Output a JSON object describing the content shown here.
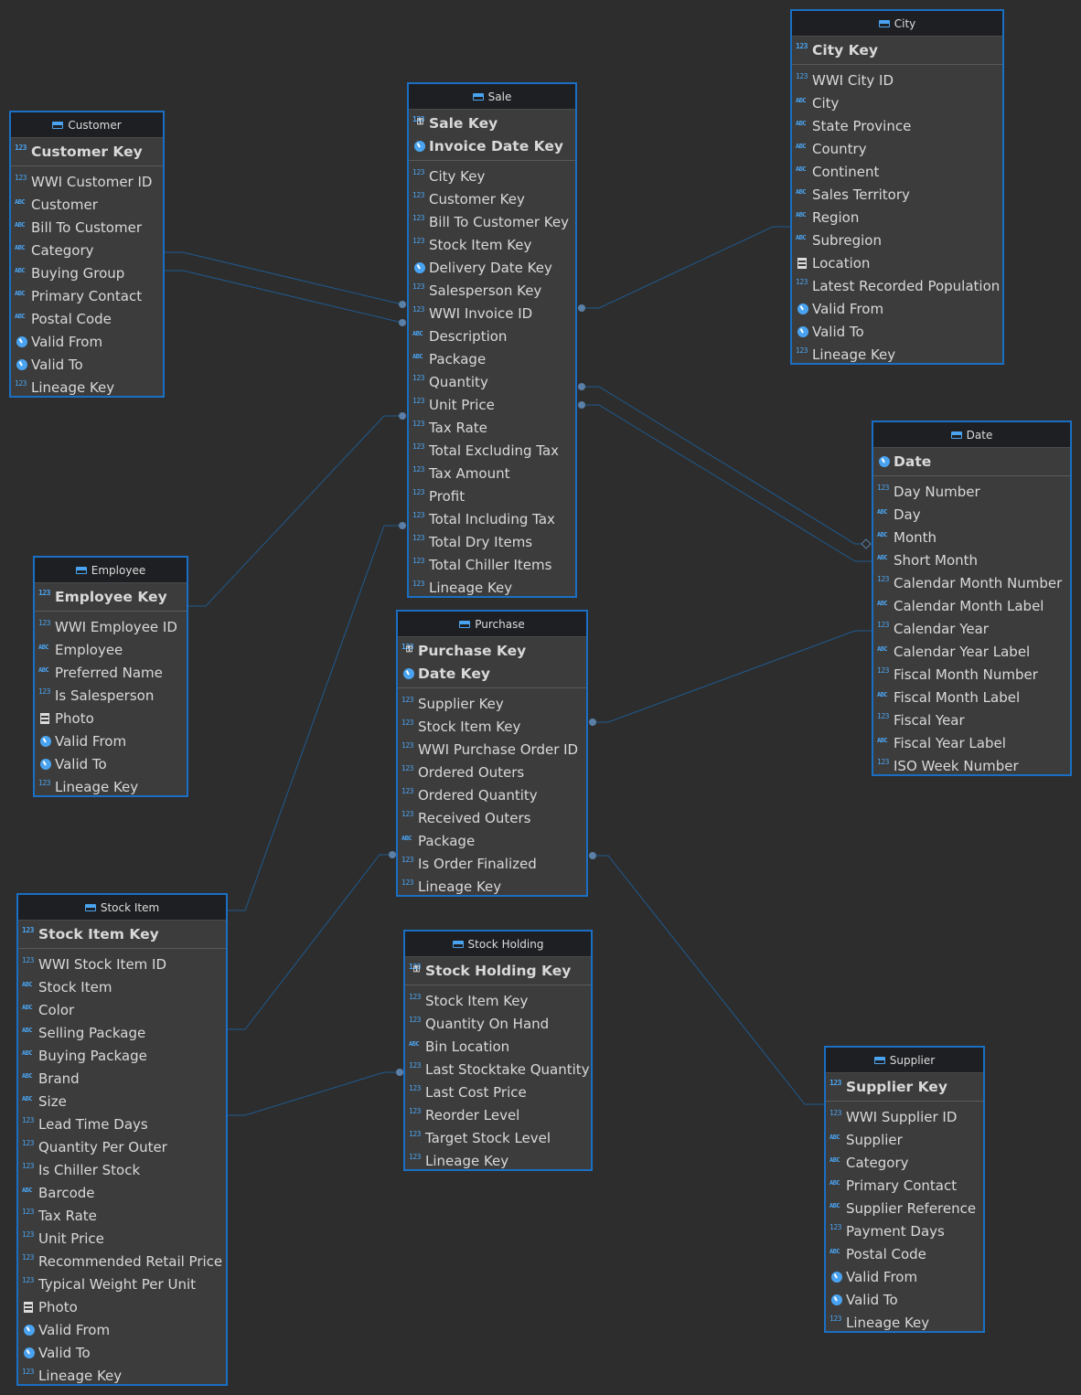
{
  "colors": {
    "background": "#2d2d2d",
    "entity_border": "#1a6fc4",
    "entity_body": "#3c3c3c",
    "type_icon": "#4aa3f0",
    "link": "#1f5a8f"
  },
  "entities": {
    "customer": {
      "title": "Customer",
      "keys": [
        {
          "type": "123",
          "label": "Customer Key"
        }
      ],
      "columns": [
        {
          "type": "123",
          "label": "WWI Customer ID"
        },
        {
          "type": "abc",
          "label": "Customer"
        },
        {
          "type": "abc",
          "label": "Bill To Customer"
        },
        {
          "type": "abc",
          "label": "Category"
        },
        {
          "type": "abc",
          "label": "Buying Group"
        },
        {
          "type": "abc",
          "label": "Primary Contact"
        },
        {
          "type": "abc",
          "label": "Postal Code"
        },
        {
          "type": "clock",
          "label": "Valid From"
        },
        {
          "type": "clock",
          "label": "Valid To"
        },
        {
          "type": "123",
          "label": "Lineage Key"
        }
      ]
    },
    "sale": {
      "title": "Sale",
      "keys": [
        {
          "type": "key",
          "label": "Sale Key"
        },
        {
          "type": "clock",
          "label": "Invoice Date Key"
        }
      ],
      "columns": [
        {
          "type": "123",
          "label": "City Key"
        },
        {
          "type": "123",
          "label": "Customer Key"
        },
        {
          "type": "123",
          "label": "Bill To Customer Key"
        },
        {
          "type": "123",
          "label": "Stock Item Key"
        },
        {
          "type": "clock",
          "label": "Delivery Date Key"
        },
        {
          "type": "123",
          "label": "Salesperson Key"
        },
        {
          "type": "123",
          "label": "WWI Invoice ID"
        },
        {
          "type": "abc",
          "label": "Description"
        },
        {
          "type": "abc",
          "label": "Package"
        },
        {
          "type": "123",
          "label": "Quantity"
        },
        {
          "type": "123",
          "label": "Unit Price"
        },
        {
          "type": "123",
          "label": "Tax Rate"
        },
        {
          "type": "123",
          "label": "Total Excluding Tax"
        },
        {
          "type": "123",
          "label": "Tax Amount"
        },
        {
          "type": "123",
          "label": "Profit"
        },
        {
          "type": "123",
          "label": "Total Including Tax"
        },
        {
          "type": "123",
          "label": "Total Dry Items"
        },
        {
          "type": "123",
          "label": "Total Chiller Items"
        },
        {
          "type": "123",
          "label": "Lineage Key"
        }
      ]
    },
    "city": {
      "title": "City",
      "keys": [
        {
          "type": "123",
          "label": "City Key"
        }
      ],
      "columns": [
        {
          "type": "123",
          "label": "WWI City ID"
        },
        {
          "type": "abc",
          "label": "City"
        },
        {
          "type": "abc",
          "label": "State Province"
        },
        {
          "type": "abc",
          "label": "Country"
        },
        {
          "type": "abc",
          "label": "Continent"
        },
        {
          "type": "abc",
          "label": "Sales Territory"
        },
        {
          "type": "abc",
          "label": "Region"
        },
        {
          "type": "abc",
          "label": "Subregion"
        },
        {
          "type": "grid",
          "label": "Location"
        },
        {
          "type": "123",
          "label": "Latest Recorded Population"
        },
        {
          "type": "clock",
          "label": "Valid From"
        },
        {
          "type": "clock",
          "label": "Valid To"
        },
        {
          "type": "123",
          "label": "Lineage Key"
        }
      ]
    },
    "date": {
      "title": "Date",
      "keys": [
        {
          "type": "clock",
          "label": "Date"
        }
      ],
      "columns": [
        {
          "type": "123",
          "label": "Day Number"
        },
        {
          "type": "abc",
          "label": "Day"
        },
        {
          "type": "abc",
          "label": "Month"
        },
        {
          "type": "abc",
          "label": "Short Month"
        },
        {
          "type": "123",
          "label": "Calendar Month Number"
        },
        {
          "type": "abc",
          "label": "Calendar Month Label"
        },
        {
          "type": "123",
          "label": "Calendar Year"
        },
        {
          "type": "abc",
          "label": "Calendar Year Label"
        },
        {
          "type": "123",
          "label": "Fiscal Month Number"
        },
        {
          "type": "abc",
          "label": "Fiscal Month Label"
        },
        {
          "type": "123",
          "label": "Fiscal Year"
        },
        {
          "type": "abc",
          "label": "Fiscal Year Label"
        },
        {
          "type": "123",
          "label": "ISO Week Number"
        }
      ]
    },
    "employee": {
      "title": "Employee",
      "keys": [
        {
          "type": "123",
          "label": "Employee Key"
        }
      ],
      "columns": [
        {
          "type": "123",
          "label": "WWI Employee ID"
        },
        {
          "type": "abc",
          "label": "Employee"
        },
        {
          "type": "abc",
          "label": "Preferred Name"
        },
        {
          "type": "123",
          "label": "Is Salesperson"
        },
        {
          "type": "grid",
          "label": "Photo"
        },
        {
          "type": "clock",
          "label": "Valid From"
        },
        {
          "type": "clock",
          "label": "Valid To"
        },
        {
          "type": "123",
          "label": "Lineage Key"
        }
      ]
    },
    "purchase": {
      "title": "Purchase",
      "keys": [
        {
          "type": "key",
          "label": "Purchase Key"
        },
        {
          "type": "clock",
          "label": "Date Key"
        }
      ],
      "columns": [
        {
          "type": "123",
          "label": "Supplier Key"
        },
        {
          "type": "123",
          "label": "Stock Item Key"
        },
        {
          "type": "123",
          "label": "WWI Purchase Order ID"
        },
        {
          "type": "123",
          "label": "Ordered Outers"
        },
        {
          "type": "123",
          "label": "Ordered Quantity"
        },
        {
          "type": "123",
          "label": "Received Outers"
        },
        {
          "type": "abc",
          "label": "Package"
        },
        {
          "type": "123",
          "label": "Is Order Finalized"
        },
        {
          "type": "123",
          "label": "Lineage Key"
        }
      ]
    },
    "stock_item": {
      "title": "Stock Item",
      "keys": [
        {
          "type": "123",
          "label": "Stock Item Key"
        }
      ],
      "columns": [
        {
          "type": "123",
          "label": "WWI Stock Item ID"
        },
        {
          "type": "abc",
          "label": "Stock Item"
        },
        {
          "type": "abc",
          "label": "Color"
        },
        {
          "type": "abc",
          "label": "Selling Package"
        },
        {
          "type": "abc",
          "label": "Buying Package"
        },
        {
          "type": "abc",
          "label": "Brand"
        },
        {
          "type": "abc",
          "label": "Size"
        },
        {
          "type": "123",
          "label": "Lead Time Days"
        },
        {
          "type": "123",
          "label": "Quantity Per Outer"
        },
        {
          "type": "123",
          "label": "Is Chiller Stock"
        },
        {
          "type": "abc",
          "label": "Barcode"
        },
        {
          "type": "123",
          "label": "Tax Rate"
        },
        {
          "type": "123",
          "label": "Unit Price"
        },
        {
          "type": "123",
          "label": "Recommended Retail Price"
        },
        {
          "type": "123",
          "label": "Typical Weight Per Unit"
        },
        {
          "type": "grid",
          "label": "Photo"
        },
        {
          "type": "clock",
          "label": "Valid From"
        },
        {
          "type": "clock",
          "label": "Valid To"
        },
        {
          "type": "123",
          "label": "Lineage Key"
        }
      ]
    },
    "stock_holding": {
      "title": "Stock Holding",
      "keys": [
        {
          "type": "key",
          "label": "Stock Holding Key"
        }
      ],
      "columns": [
        {
          "type": "123",
          "label": "Stock Item Key"
        },
        {
          "type": "123",
          "label": "Quantity On Hand"
        },
        {
          "type": "abc",
          "label": "Bin Location"
        },
        {
          "type": "123",
          "label": "Last Stocktake Quantity"
        },
        {
          "type": "123",
          "label": "Last Cost Price"
        },
        {
          "type": "123",
          "label": "Reorder Level"
        },
        {
          "type": "123",
          "label": "Target Stock Level"
        },
        {
          "type": "123",
          "label": "Lineage Key"
        }
      ]
    },
    "supplier": {
      "title": "Supplier",
      "keys": [
        {
          "type": "123",
          "label": "Supplier Key"
        }
      ],
      "columns": [
        {
          "type": "123",
          "label": "WWI Supplier ID"
        },
        {
          "type": "abc",
          "label": "Supplier"
        },
        {
          "type": "abc",
          "label": "Category"
        },
        {
          "type": "abc",
          "label": "Primary Contact"
        },
        {
          "type": "abc",
          "label": "Supplier Reference"
        },
        {
          "type": "123",
          "label": "Payment Days"
        },
        {
          "type": "abc",
          "label": "Postal Code"
        },
        {
          "type": "clock",
          "label": "Valid From"
        },
        {
          "type": "clock",
          "label": "Valid To"
        },
        {
          "type": "123",
          "label": "Lineage Key"
        }
      ]
    }
  }
}
